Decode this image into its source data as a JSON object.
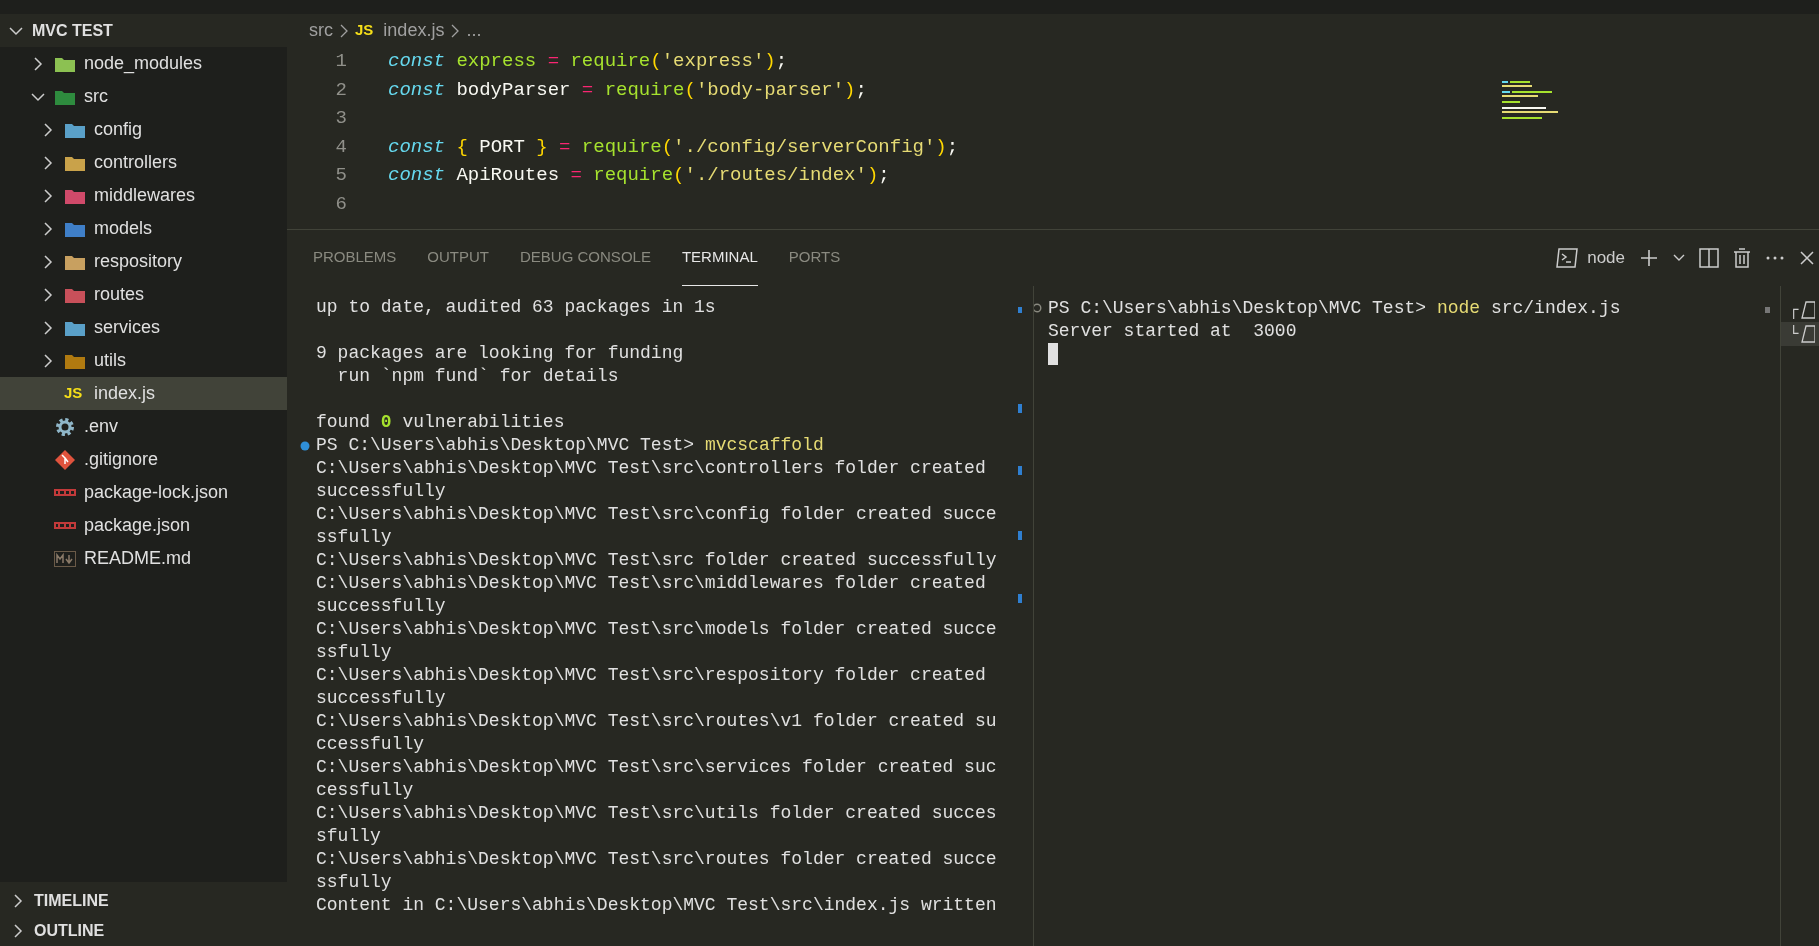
{
  "explorer": {
    "title": "MVC TEST",
    "expanded": true,
    "items": [
      {
        "label": "node_modules",
        "kind": "folder",
        "color": "#8cc152",
        "expanded": false
      },
      {
        "label": "src",
        "kind": "folder",
        "color": "#2e8b3e",
        "expanded": true,
        "children": [
          {
            "label": "config",
            "kind": "folder",
            "color": "#5aa0c8",
            "expanded": false
          },
          {
            "label": "controllers",
            "kind": "folder",
            "color": "#c9a24a",
            "expanded": false
          },
          {
            "label": "middlewares",
            "kind": "folder",
            "color": "#d04a6a",
            "expanded": false
          },
          {
            "label": "models",
            "kind": "folder",
            "color": "#3f7fc8",
            "expanded": false
          },
          {
            "label": "respository",
            "kind": "folder",
            "color": "#c8a060",
            "expanded": false
          },
          {
            "label": "routes",
            "kind": "folder",
            "color": "#c8505a",
            "expanded": false
          },
          {
            "label": "services",
            "kind": "folder",
            "color": "#5aa0c8",
            "expanded": false
          },
          {
            "label": "utils",
            "kind": "folder",
            "color": "#b07a10",
            "expanded": false
          },
          {
            "label": "index.js",
            "kind": "js",
            "badge": "JS",
            "selected": true
          }
        ]
      },
      {
        "label": ".env",
        "kind": "settings",
        "selected": false
      },
      {
        "label": ".gitignore",
        "kind": "git",
        "selected": false
      },
      {
        "label": "package-lock.json",
        "kind": "npm",
        "selected": false
      },
      {
        "label": "package.json",
        "kind": "npm",
        "selected": false
      },
      {
        "label": "README.md",
        "kind": "markdown",
        "selected": false
      }
    ]
  },
  "sections": [
    {
      "title": "TIMELINE",
      "expanded": false
    },
    {
      "title": "OUTLINE",
      "expanded": false
    }
  ],
  "breadcrumb": {
    "folder": "src",
    "file_badge": "JS",
    "file": "index.js",
    "more": "..."
  },
  "code": [
    {
      "number": "1",
      "tokens": [
        {
          "t": "const",
          "kind": "keyword"
        },
        {
          "t": " express",
          "kind": "def"
        },
        {
          "t": " =",
          "kind": "op"
        },
        {
          "t": " require",
          "kind": "fn"
        },
        {
          "t": "(",
          "kind": "paren"
        },
        {
          "t": "'express'",
          "kind": "string"
        },
        {
          "t": ")",
          "kind": "paren"
        },
        {
          "t": ";",
          "kind": "plain"
        }
      ]
    },
    {
      "number": "2",
      "tokens": [
        {
          "t": "const",
          "kind": "keyword"
        },
        {
          "t": " bodyParser",
          "kind": "plain"
        },
        {
          "t": " =",
          "kind": "op"
        },
        {
          "t": " require",
          "kind": "fn"
        },
        {
          "t": "(",
          "kind": "paren"
        },
        {
          "t": "'body-parser'",
          "kind": "string"
        },
        {
          "t": ")",
          "kind": "paren"
        },
        {
          "t": ";",
          "kind": "plain"
        }
      ]
    },
    {
      "number": "3"
    },
    {
      "number": "4",
      "tokens": [
        {
          "t": "const",
          "kind": "keyword"
        },
        {
          "t": " {",
          "kind": "paren"
        },
        {
          "t": " PORT",
          "kind": "plain"
        },
        {
          "t": " }",
          "kind": "paren"
        },
        {
          "t": " =",
          "kind": "op"
        },
        {
          "t": " require",
          "kind": "fn"
        },
        {
          "t": "(",
          "kind": "paren"
        },
        {
          "t": "'./config/serverConfig'",
          "kind": "string"
        },
        {
          "t": ")",
          "kind": "paren"
        },
        {
          "t": ";",
          "kind": "plain"
        }
      ]
    },
    {
      "number": "5",
      "tokens": [
        {
          "t": "const",
          "kind": "keyword"
        },
        {
          "t": " ApiRoutes",
          "kind": "plain"
        },
        {
          "t": " =",
          "kind": "op"
        },
        {
          "t": " require",
          "kind": "fn"
        },
        {
          "t": "(",
          "kind": "paren"
        },
        {
          "t": "'./routes/index'",
          "kind": "string"
        },
        {
          "t": ")",
          "kind": "paren"
        },
        {
          "t": ";",
          "kind": "plain"
        }
      ]
    },
    {
      "number": "6"
    }
  ],
  "panel": {
    "tabs": [
      {
        "label": "PROBLEMS",
        "selected": false
      },
      {
        "label": "OUTPUT",
        "selected": false
      },
      {
        "label": "DEBUG CONSOLE",
        "selected": false
      },
      {
        "label": "TERMINAL",
        "selected": true
      },
      {
        "label": "PORTS",
        "selected": false
      }
    ],
    "terminal_name": "node"
  },
  "terminal_left": [
    {
      "kind": "output",
      "segments": [
        {
          "t": "up to date, audited 63 packages in 1s",
          "kind": "plain"
        }
      ]
    },
    {
      "kind": "blank"
    },
    {
      "kind": "output",
      "segments": [
        {
          "t": "9 packages are looking for funding",
          "kind": "plain"
        }
      ]
    },
    {
      "kind": "output",
      "segments": [
        {
          "t": "  run `npm fund` for details",
          "kind": "plain"
        }
      ]
    },
    {
      "kind": "blank"
    },
    {
      "kind": "output",
      "segments": [
        {
          "t": "found ",
          "kind": "plain"
        },
        {
          "t": "0",
          "kind": "number"
        },
        {
          "t": " vulnerabilities",
          "kind": "plain"
        }
      ]
    },
    {
      "kind": "prompt",
      "marker_filled": true,
      "segments": [
        {
          "t": "PS C:\\Users\\abhis\\Desktop\\MVC Test> ",
          "kind": "plain"
        },
        {
          "t": "mvcscaffold",
          "kind": "command"
        }
      ]
    },
    {
      "kind": "output",
      "segments": [
        {
          "t": "C:\\Users\\abhis\\Desktop\\MVC Test\\src\\controllers folder created",
          "kind": "plain"
        }
      ]
    },
    {
      "kind": "output",
      "segments": [
        {
          "t": "successfully",
          "kind": "plain"
        }
      ]
    },
    {
      "kind": "output",
      "segments": [
        {
          "t": "C:\\Users\\abhis\\Desktop\\MVC Test\\src\\config folder created succe",
          "kind": "plain"
        }
      ]
    },
    {
      "kind": "output",
      "segments": [
        {
          "t": "ssfully",
          "kind": "plain"
        }
      ]
    },
    {
      "kind": "output",
      "segments": [
        {
          "t": "C:\\Users\\abhis\\Desktop\\MVC Test\\src folder created successfully",
          "kind": "plain"
        }
      ]
    },
    {
      "kind": "output",
      "segments": [
        {
          "t": "C:\\Users\\abhis\\Desktop\\MVC Test\\src\\middlewares folder created",
          "kind": "plain"
        }
      ]
    },
    {
      "kind": "output",
      "segments": [
        {
          "t": "successfully",
          "kind": "plain"
        }
      ]
    },
    {
      "kind": "output",
      "segments": [
        {
          "t": "C:\\Users\\abhis\\Desktop\\MVC Test\\src\\models folder created succe",
          "kind": "plain"
        }
      ]
    },
    {
      "kind": "output",
      "segments": [
        {
          "t": "ssfully",
          "kind": "plain"
        }
      ]
    },
    {
      "kind": "output",
      "segments": [
        {
          "t": "C:\\Users\\abhis\\Desktop\\MVC Test\\src\\respository folder created",
          "kind": "plain"
        }
      ]
    },
    {
      "kind": "output",
      "segments": [
        {
          "t": "successfully",
          "kind": "plain"
        }
      ]
    },
    {
      "kind": "output",
      "segments": [
        {
          "t": "C:\\Users\\abhis\\Desktop\\MVC Test\\src\\routes\\v1 folder created su",
          "kind": "plain"
        }
      ]
    },
    {
      "kind": "output",
      "segments": [
        {
          "t": "ccessfully",
          "kind": "plain"
        }
      ]
    },
    {
      "kind": "output",
      "segments": [
        {
          "t": "C:\\Users\\abhis\\Desktop\\MVC Test\\src\\services folder created suc",
          "kind": "plain"
        }
      ]
    },
    {
      "kind": "output",
      "segments": [
        {
          "t": "cessfully",
          "kind": "plain"
        }
      ]
    },
    {
      "kind": "output",
      "segments": [
        {
          "t": "C:\\Users\\abhis\\Desktop\\MVC Test\\src\\utils folder created succes",
          "kind": "plain"
        }
      ]
    },
    {
      "kind": "output",
      "segments": [
        {
          "t": "sfully",
          "kind": "plain"
        }
      ]
    },
    {
      "kind": "output",
      "segments": [
        {
          "t": "C:\\Users\\abhis\\Desktop\\MVC Test\\src\\routes folder created succe",
          "kind": "plain"
        }
      ]
    },
    {
      "kind": "output",
      "segments": [
        {
          "t": "ssfully",
          "kind": "plain"
        }
      ]
    },
    {
      "kind": "output",
      "segments": [
        {
          "t": "Content in C:\\Users\\abhis\\Desktop\\MVC Test\\src\\index.js written",
          "kind": "plain"
        }
      ]
    }
  ],
  "terminal_right": [
    {
      "kind": "prompt",
      "marker_filled": false,
      "segments": [
        {
          "t": "PS C:\\Users\\abhis\\Desktop\\MVC Test> ",
          "kind": "plain"
        },
        {
          "t": "node",
          "kind": "command"
        },
        {
          "t": " src/index.js",
          "kind": "plain"
        }
      ]
    },
    {
      "kind": "output",
      "segments": [
        {
          "t": "Server started at  3000",
          "kind": "plain"
        }
      ]
    },
    {
      "kind": "cursor"
    }
  ],
  "terminal_list": [
    {
      "branch": "┌",
      "selected": false
    },
    {
      "branch": "└",
      "selected": true
    }
  ]
}
